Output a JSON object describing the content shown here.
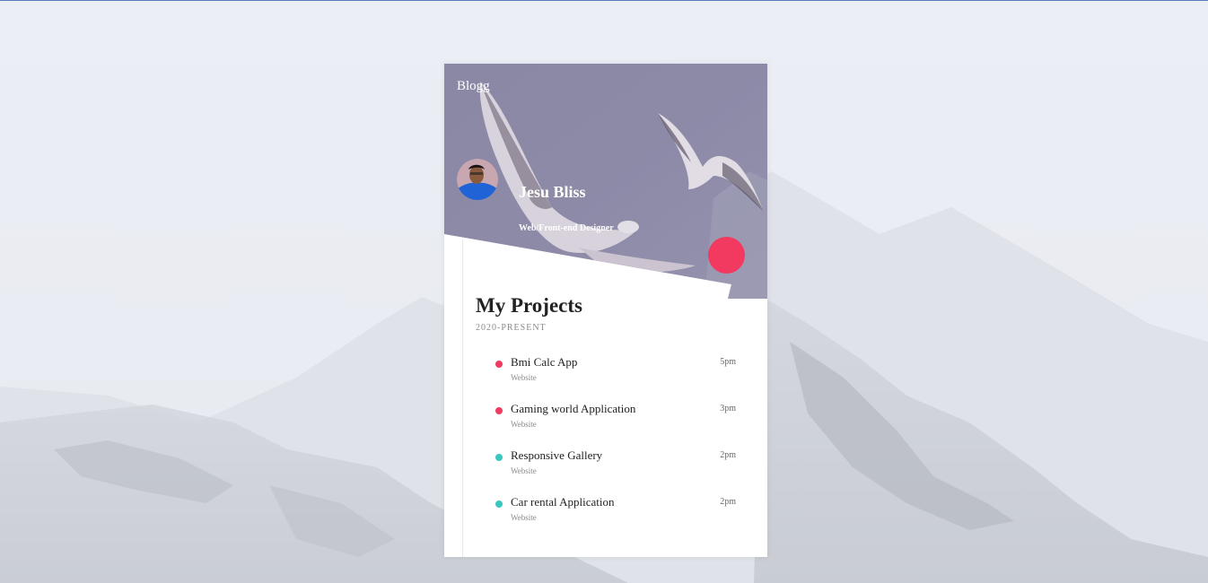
{
  "brand": "Blogg",
  "profile": {
    "name": "Jesu Bliss",
    "role": "Web/Front-end Designer"
  },
  "section": {
    "title": "My Projects",
    "subtitle": "2020-PRESENT"
  },
  "projects": [
    {
      "title": "Bmi Calc App",
      "type": "Website",
      "time": "5pm",
      "color": "#ef3b62"
    },
    {
      "title": "Gaming world Application",
      "type": "Website",
      "time": "3pm",
      "color": "#ef3b62"
    },
    {
      "title": "Responsive Gallery",
      "type": "Website",
      "time": "2pm",
      "color": "#3cc6c0"
    },
    {
      "title": "Car rental Application",
      "type": "Website",
      "time": "2pm",
      "color": "#3cc6c0"
    }
  ],
  "colors": {
    "accent": "#f2395f",
    "teal": "#3cc6c0",
    "header_tint": "#8a88a8"
  }
}
